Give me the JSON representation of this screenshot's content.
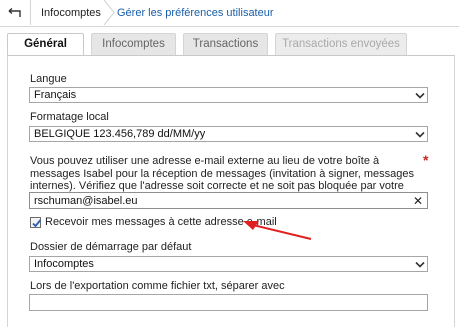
{
  "breadcrumb": {
    "back_label": "",
    "item1": "Infocomptes",
    "item2": "Gérer les préférences utilisateur"
  },
  "tabs": [
    {
      "label": "Général",
      "state": "active"
    },
    {
      "label": "Infocomptes",
      "state": "normal"
    },
    {
      "label": "Transactions",
      "state": "normal"
    },
    {
      "label": "Transactions envoyées",
      "state": "disabled"
    }
  ],
  "form": {
    "language_label": "Langue",
    "language_value": "Français",
    "format_label": "Formatage local",
    "format_value": "BELGIQUE 123.456,789 dd/MM/yy",
    "email_help": "Vous pouvez utiliser une adresse e-mail externe au lieu de votre boîte à messages Isabel pour la réception de messages (invitation à signer, messages internes). Vérifiez que l'adresse soit correcte et ne soit pas bloquée par votre système de messagerie.",
    "required_marker": "*",
    "email_value": "rschuman@isabel.eu",
    "receive_label": "Recevoir mes messages à cette adresse e-mail",
    "receive_checked": true,
    "start_folder_label": "Dossier de démarrage par défaut",
    "start_folder_value": "Infocomptes",
    "export_label": "Lors de l'exportation comme fichier txt, séparer avec",
    "export_value": ""
  },
  "colors": {
    "link": "#1a5fa8",
    "annotation_arrow": "#e02020",
    "required": "#c62828"
  }
}
